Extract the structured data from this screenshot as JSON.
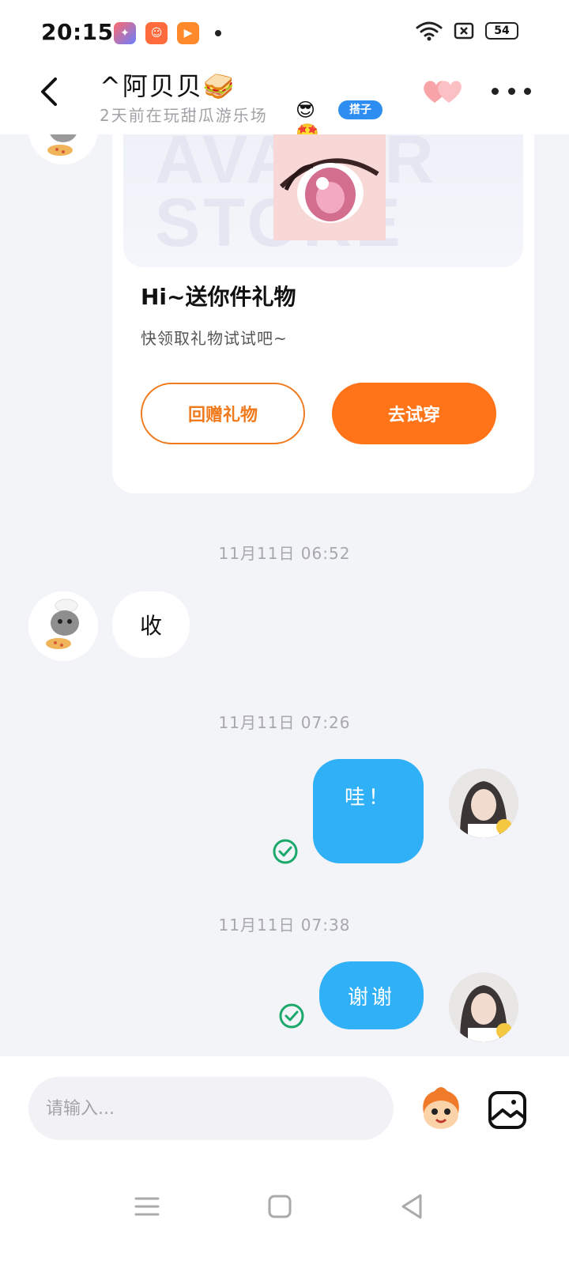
{
  "status_bar": {
    "time": "20:15",
    "battery": "54",
    "app_icons": [
      "app-icon-1",
      "app-icon-2",
      "app-icon-3"
    ],
    "wifi_icon": "wifi-icon",
    "sim_icon": "sim-icon"
  },
  "header": {
    "title": "^阿贝贝🥪",
    "subtitle": "2天前在玩甜瓜游乐场",
    "badge_tag": "搭子",
    "back_icon": "back-arrow-icon",
    "heart_icon": "hearts-icon",
    "more_icon": "more-icon"
  },
  "gift_card": {
    "banner_text": "AVATAR STORE",
    "title": "Hi~送你件礼物",
    "description": "快领取礼物试试吧~",
    "return_button": "回赠礼物",
    "try_button": "去试穿"
  },
  "messages": [
    {
      "timestamp": "11月11日 06:52",
      "sender": "other",
      "text": "收"
    },
    {
      "timestamp": "11月11日 07:26",
      "sender": "me",
      "text": "哇！"
    },
    {
      "timestamp": "11月11日 07:38",
      "sender": "me",
      "text": "谢谢"
    }
  ],
  "input": {
    "placeholder": "请输入..."
  },
  "colors": {
    "accent_orange": "#ff7418",
    "bubble_blue": "#2fb0f7",
    "tag_blue": "#2e8df0",
    "read_green": "#1aa86b",
    "background": "#f3f4f8"
  }
}
